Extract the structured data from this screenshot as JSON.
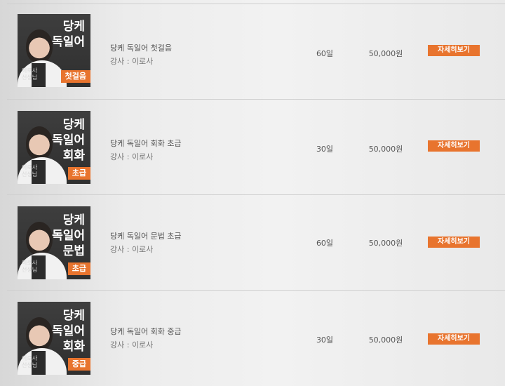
{
  "courses": [
    {
      "thumb_lines": [
        "당케",
        "독일어"
      ],
      "thumb_badge": "첫걸음",
      "thumb_caption": "이로사 선생님",
      "title": "당케 독일어 첫걸음",
      "instructor": "강사 : 이로사",
      "days": "60일",
      "price": "50,000원",
      "button": "자세히보기"
    },
    {
      "thumb_lines": [
        "당케",
        "독일어",
        "회화"
      ],
      "thumb_badge": "초급",
      "thumb_caption": "이로사 선생님",
      "title": "당케 독일어 회화 초급",
      "instructor": "강사 : 이로사",
      "days": "30일",
      "price": "50,000원",
      "button": "자세히보기"
    },
    {
      "thumb_lines": [
        "당케",
        "독일어",
        "문법"
      ],
      "thumb_badge": "초급",
      "thumb_caption": "이로사 선생님",
      "title": "당케 독일어 문법 초급",
      "instructor": "강사 : 이로사",
      "days": "60일",
      "price": "50,000원",
      "button": "자세히보기"
    },
    {
      "thumb_lines": [
        "당케",
        "독일어",
        "회화"
      ],
      "thumb_badge": "중급",
      "thumb_caption": "이로사 선생님",
      "title": "당케 독일어 회화 중급",
      "instructor": "강사 : 이로사",
      "days": "30일",
      "price": "50,000원",
      "button": "자세히보기"
    }
  ],
  "colors": {
    "accent": "#e8742e",
    "thumb_bg": "#333333"
  }
}
